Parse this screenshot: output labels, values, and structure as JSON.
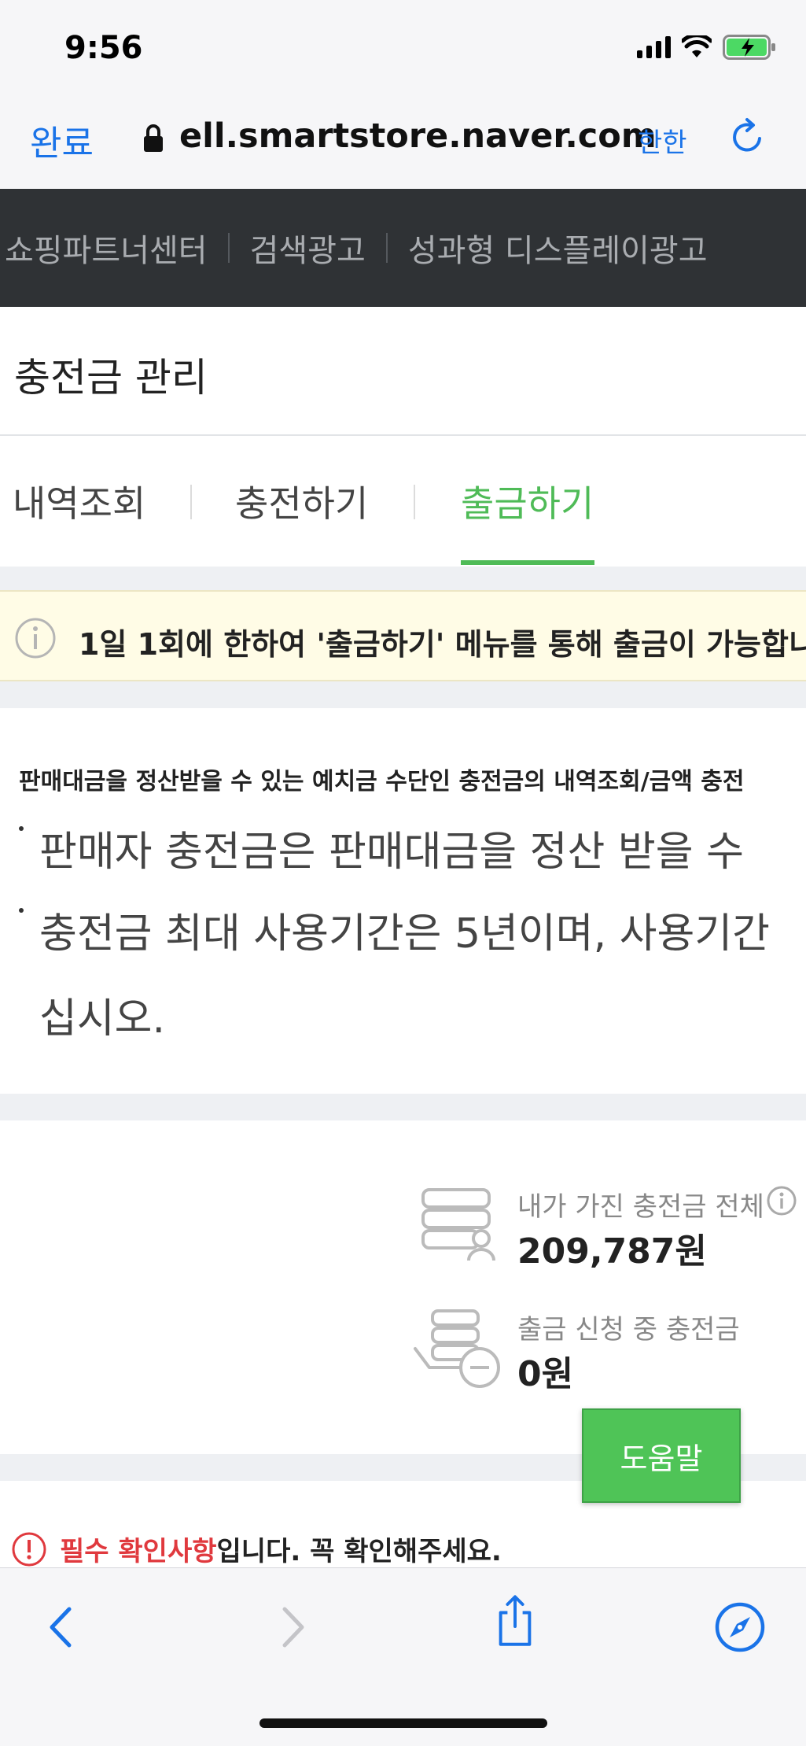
{
  "status_bar": {
    "time": "9:56"
  },
  "browser": {
    "done_label": "완료",
    "url": "ell.smartstore.naver.com",
    "translate_label": "한한"
  },
  "top_nav": {
    "items": [
      "쇼핑파트너센터",
      "검색광고",
      "성과형 디스플레이광고"
    ]
  },
  "page": {
    "title": "충전금 관리"
  },
  "tabs": [
    {
      "label": "내역조회",
      "active": false
    },
    {
      "label": "충전하기",
      "active": false
    },
    {
      "label": "출금하기",
      "active": true
    }
  ],
  "notice": {
    "text": "1일 1회에 한하여 '출금하기' 메뉴를 통해 출금이 가능합니"
  },
  "info": {
    "intro": "판매대금을 정산받을 수 있는 예치금 수단인 충전금의 내역조회/금액 충전",
    "lines": [
      "판매자 충전금은 판매대금을 정산 받을 수",
      "충전금 최대 사용기간은 5년이며, 사용기간",
      "십시오."
    ]
  },
  "balance": {
    "total_label": "내가 가진 충전금 전체",
    "total_value": "209,787원",
    "pending_label": "출금 신청 중 충전금",
    "pending_value": "0원"
  },
  "help_button": {
    "label": "도움말"
  },
  "required_notice": {
    "highlight": "필수 확인사항",
    "rest": "입니다. 꼭 확인해주세요."
  },
  "colors": {
    "accent_green": "#4fbb57",
    "link_blue": "#1a73e8",
    "alert_red": "#e0393e",
    "nav_dark": "#2f3235"
  }
}
